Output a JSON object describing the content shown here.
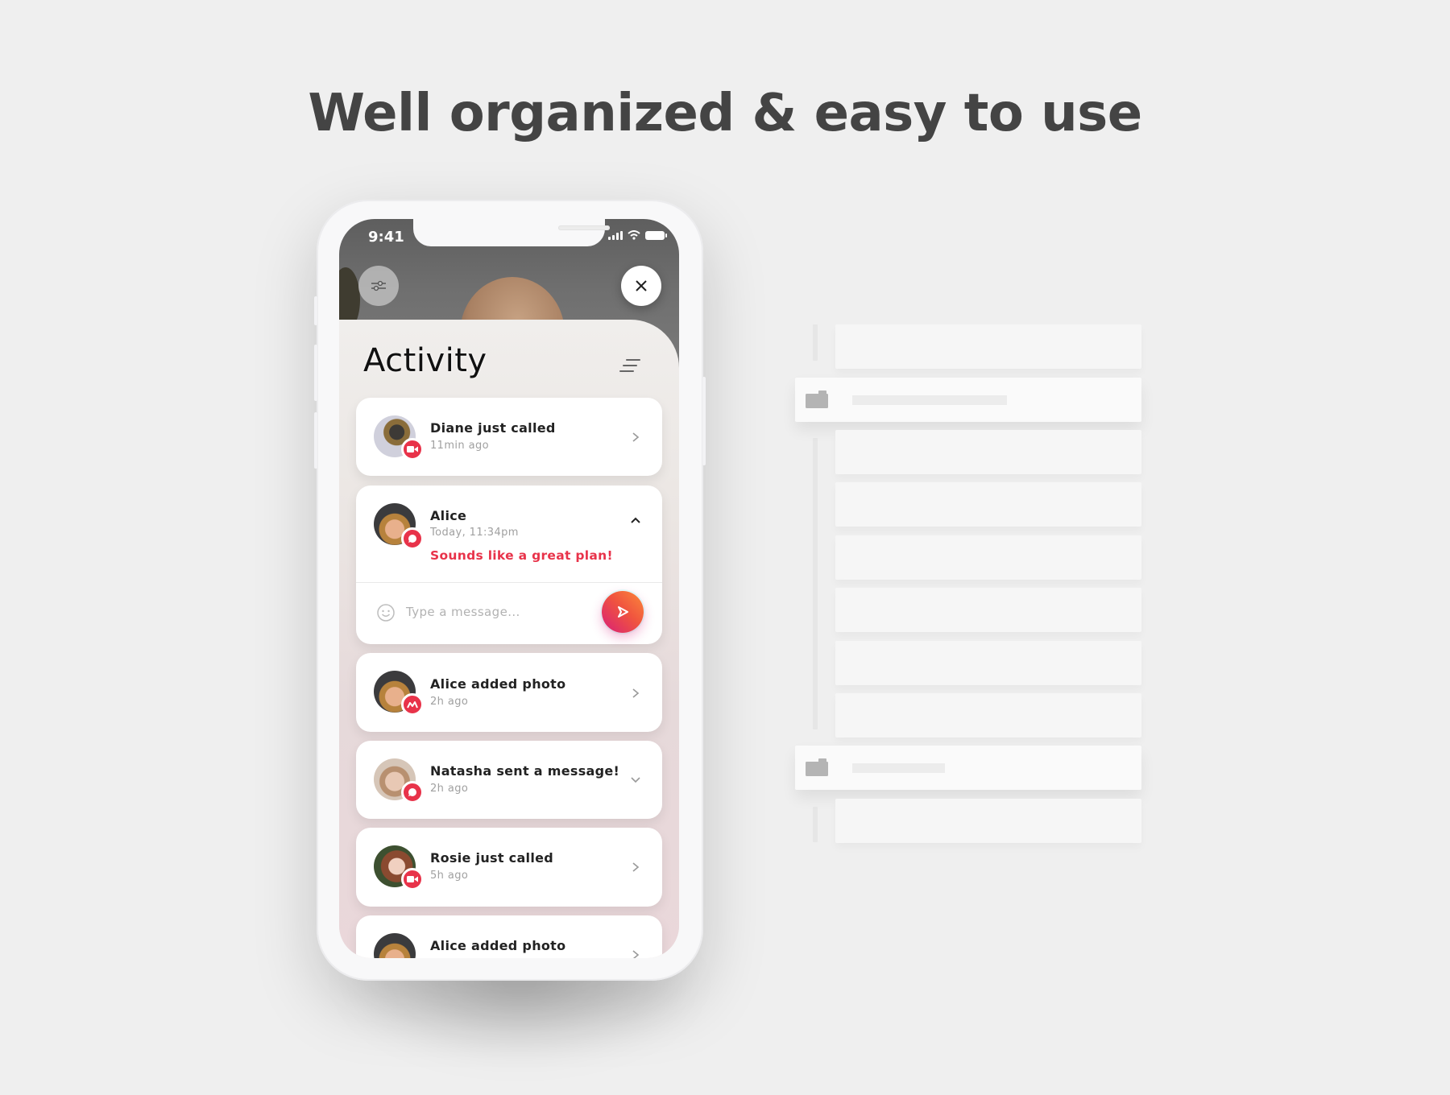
{
  "headline": "Well organized & easy to use",
  "phone": {
    "status_bar": {
      "time": "9:41",
      "icons": [
        "signal-icon",
        "wifi-icon",
        "battery-icon"
      ]
    },
    "header_buttons": {
      "left": "filter-sliders-icon",
      "right": "close-icon"
    },
    "activity": {
      "title": "Activity",
      "menu_icon": "sort-menu-icon",
      "accent_color": "#e8334a",
      "items": [
        {
          "title": "Diane just called",
          "subtitle": "11min ago",
          "badge": "video-call-icon",
          "action": "chevron-right-icon"
        },
        {
          "title": "Alice",
          "subtitle": "Today, 11:34pm",
          "badge": "chat-bubble-icon",
          "action": "chevron-up-icon",
          "message": "Sounds like a great plan!",
          "reply": {
            "placeholder": "Type a message...",
            "emoji_icon": "smiley-icon",
            "send_icon": "send-icon"
          }
        },
        {
          "title": "Alice added photo",
          "subtitle": "2h ago",
          "badge": "photo-icon",
          "action": "chevron-right-icon"
        },
        {
          "title": "Natasha sent a message!",
          "subtitle": "2h ago",
          "badge": "chat-bubble-icon",
          "action": "chevron-down-icon"
        },
        {
          "title": "Rosie just called",
          "subtitle": "5h ago",
          "badge": "video-call-icon",
          "action": "chevron-right-icon"
        },
        {
          "title": "Alice added photo",
          "subtitle": "",
          "badge": "photo-icon",
          "action": "chevron-right-icon"
        }
      ]
    }
  },
  "wireframe": {
    "description": "skeleton list of grouped rows",
    "groups": [
      {
        "folder_icon": "folder-icon",
        "rows_before": 1,
        "rows_after": 7
      },
      {
        "folder_icon": "folder-icon",
        "rows_after": 1
      }
    ]
  }
}
